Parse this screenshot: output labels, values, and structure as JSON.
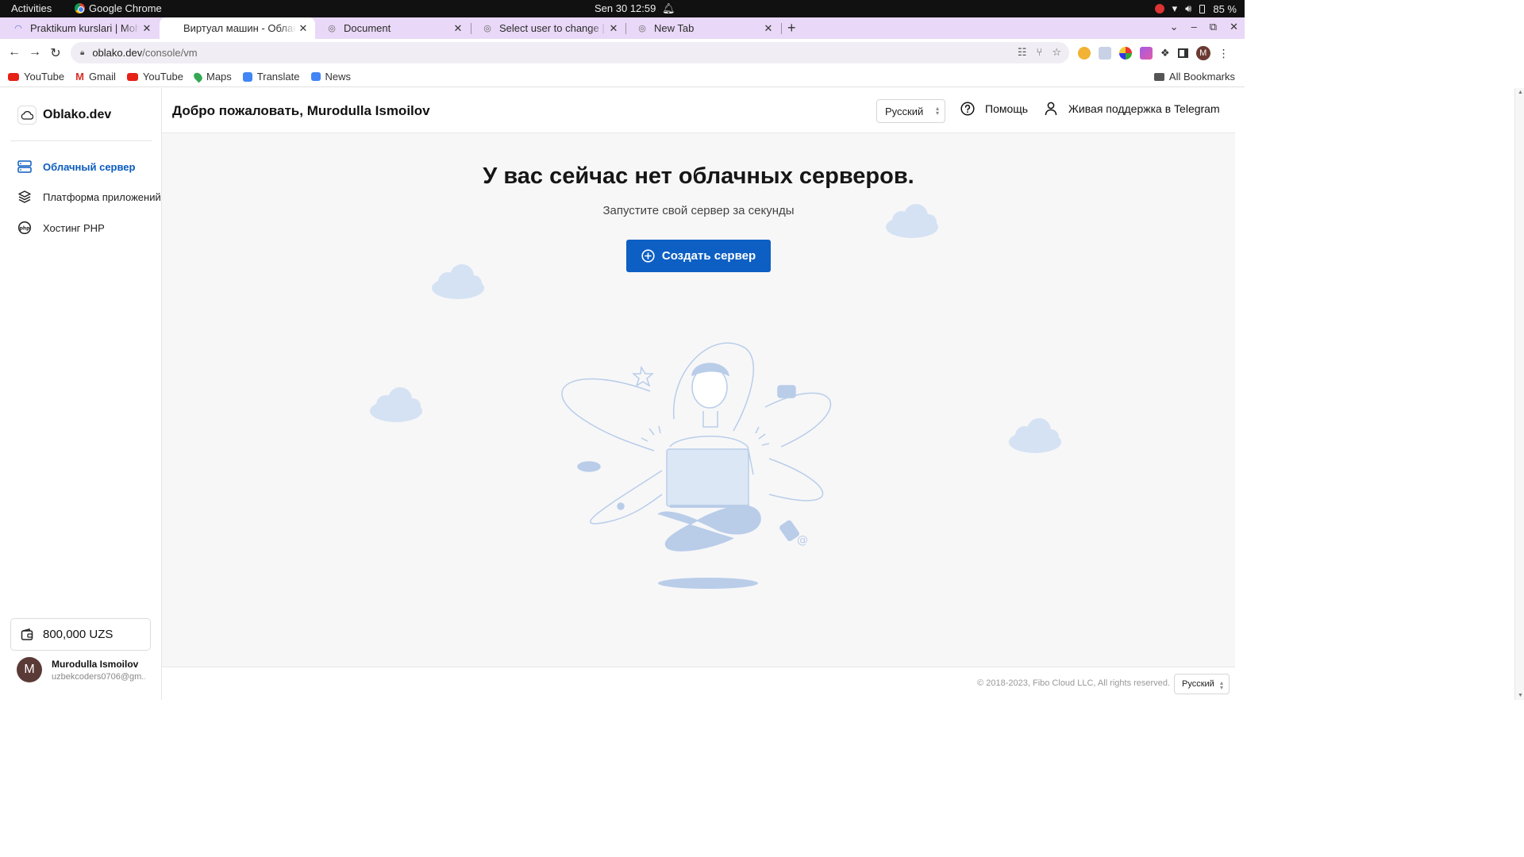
{
  "os_bar": {
    "activities": "Activities",
    "app_name": "Google Chrome",
    "clock": "Sen 30  12:59",
    "battery": "85 %"
  },
  "tabs": [
    {
      "title": "Praktikum kurslari | Mohirdev",
      "active": false
    },
    {
      "title": "Виртуал машин - Облако",
      "active": true
    },
    {
      "title": "Document",
      "active": false
    },
    {
      "title": "Select user to change | Django",
      "active": false
    },
    {
      "title": "New Tab",
      "active": false
    }
  ],
  "address_bar": {
    "host": "oblako.dev",
    "path": "/console/vm"
  },
  "bookmarks": [
    {
      "label": "YouTube",
      "icon": "youtube-icon",
      "color": "#e62117"
    },
    {
      "label": "Gmail",
      "icon": "gmail-icon",
      "color": "#d93025"
    },
    {
      "label": "YouTube",
      "icon": "youtube-icon",
      "color": "#e62117"
    },
    {
      "label": "Maps",
      "icon": "maps-icon",
      "color": "#34a853"
    },
    {
      "label": "Translate",
      "icon": "translate-icon",
      "color": "#4285f4"
    },
    {
      "label": "News",
      "icon": "news-icon",
      "color": "#4285f4"
    }
  ],
  "all_bookmarks": "All Bookmarks",
  "sidebar": {
    "logo": "Oblako.dev",
    "items": [
      {
        "label": "Облачный сервер",
        "icon": "server-icon",
        "active": true
      },
      {
        "label": "Платформа приложений",
        "icon": "layers-icon",
        "active": false
      },
      {
        "label": "Хостинг PHP",
        "icon": "php-icon",
        "active": false
      }
    ],
    "balance": "800,000 UZS",
    "user": {
      "initial": "M",
      "name": "Murodulla Ismoilov",
      "email": "uzbekcoders0706@gm..."
    }
  },
  "header": {
    "welcome": "Добро пожаловать, Murodulla Ismoilov",
    "language": "Русский",
    "help": "Помощь",
    "support": "Живая поддержка в Telegram"
  },
  "main": {
    "empty_title": "У вас сейчас нет облачных серверов.",
    "empty_subtitle": "Запустите свой сервер за секунды",
    "create_button": "Создать сервер"
  },
  "footer": {
    "copyright": "© 2018-2023, Fibo Cloud LLC, All rights reserved.",
    "language": "Русский"
  },
  "colors": {
    "accent": "#0d5fc4",
    "tab_strip": "#e9d8f7",
    "illustration": "#b9cde9"
  }
}
